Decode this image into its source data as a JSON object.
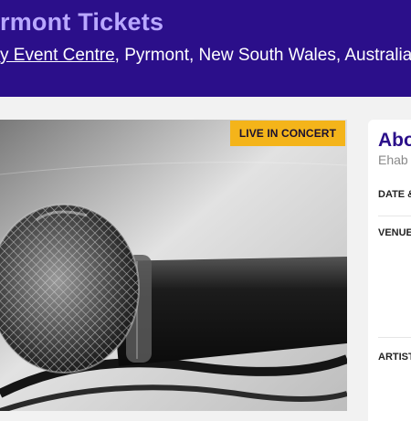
{
  "header": {
    "title": "rmont Tickets",
    "venue_link": "y Event Centre",
    "location_rest": ", Pyrmont, New South Wales, Australia"
  },
  "hero": {
    "badge": "LIVE IN CONCERT",
    "image_alt": "microphone-photo"
  },
  "about": {
    "heading": "Abo",
    "subheading": "Ehab T",
    "rows": [
      {
        "label": "DATE &"
      },
      {
        "label": "VENUE"
      },
      {
        "label": "ARTIST"
      }
    ]
  },
  "colors": {
    "header_bg": "#2b0f8a",
    "title": "#b9a8ff",
    "badge_bg": "#f4b41a"
  }
}
